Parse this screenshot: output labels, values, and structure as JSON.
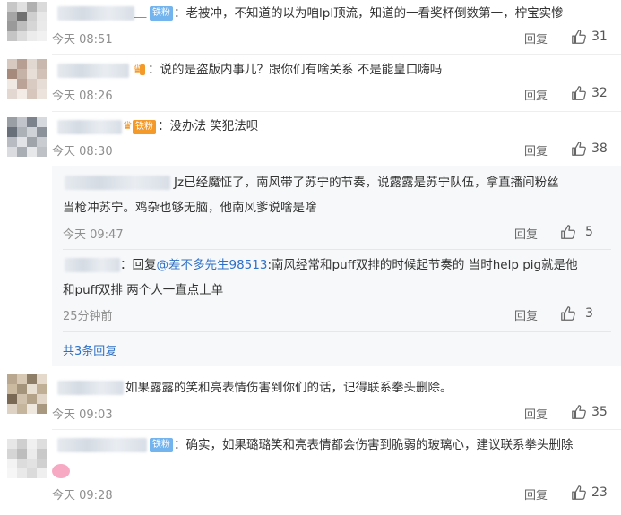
{
  "comments": [
    {
      "badge": "铁粉",
      "text": "：老被冲，不知道的以为咱lpl顶流，知道的一看奖杯倒数第一，柠宝实惨",
      "time": "今天 08:51",
      "reply_label": "回复",
      "likes": "31",
      "prefix": "＿",
      "avatar_colors": [
        "#c7c7c7",
        "#e0e0e0",
        "#b0b0b0",
        "#dadada",
        "#a5a5a5",
        "#707070",
        "#cfcfcf",
        "#e8e8e8",
        "#9a9a9a",
        "#bdbdbd",
        "#d6d6d6",
        "#eaeaea",
        "#c5c5c5",
        "#dcdcdc",
        "#ececec",
        "#f1f1f1"
      ]
    },
    {
      "badge": "",
      "text": "：说的是盗版内事儿？跟你们有啥关系 不是能皇口嗨吗",
      "time": "今天 08:26",
      "reply_label": "回复",
      "likes": "32",
      "avatar_colors": [
        "#d8c9c0",
        "#b89f94",
        "#e2d8d2",
        "#c9b8ad",
        "#a68a7c",
        "#c6b3a8",
        "#e8ded8",
        "#d2c1b7",
        "#f0e8e3",
        "#bba497",
        "#d9cbc2",
        "#e6ddd7",
        "#e3d8d1",
        "#f2ebe6",
        "#d7c6bc",
        "#ece3dd"
      ]
    },
    {
      "badge": "铁粉",
      "text": "：没办法  笑犯法呗",
      "time": "今天 08:30",
      "reply_label": "回复",
      "likes": "38",
      "avatar_colors": [
        "#9a9fa6",
        "#c1c5cb",
        "#7d838c",
        "#d6d9dd",
        "#686f78",
        "#acb1b8",
        "#cfd2d6",
        "#8c929a",
        "#b8bcc2",
        "#e1e3e6",
        "#9fa4ab",
        "#c9ccd0",
        "#dadcdf",
        "#a9aeb4",
        "#e6e8ea",
        "#bec2c7"
      ]
    },
    {
      "badge": "",
      "text": "如果露露的笑和亮表情伤害到你们的话，记得联系拳头删除。",
      "time": "今天 09:03",
      "reply_label": "回复",
      "likes": "35",
      "avatar_colors": [
        "#b9a88f",
        "#d7c8b4",
        "#8e7d67",
        "#e4d9ca",
        "#cbb9a0",
        "#a5947c",
        "#e9e0d4",
        "#c0ae95",
        "#7a6a55",
        "#d0c1ad",
        "#b3a188",
        "#e0d5c6",
        "#ddd2c3",
        "#c6b59d",
        "#efe8de",
        "#a99880"
      ]
    },
    {
      "badge": "铁粉",
      "text": "：确实，如果璐璐笑和亮表情都会伤害到脆弱的玻璃心，建议联系拳头删除",
      "time": "今天 09:28",
      "reply_label": "回复",
      "likes": "23",
      "avatar_colors": [
        "#e7e7e7",
        "#cfcfcf",
        "#f0f0f0",
        "#dedede",
        "#d5d5d5",
        "#bdbdbd",
        "#ebebeb",
        "#c9c9c9",
        "#f3f3f3",
        "#dcdcdc",
        "#e2e2e2",
        "#d0d0d0",
        "#f6f6f6",
        "#e9e9e9",
        "#dbdbdb",
        "#efefef"
      ]
    }
  ],
  "replies": [
    {
      "text_line1": "Jz已经魔怔了，南风带了苏宁的节奏，说露露是苏宁队伍，拿直播间粉丝",
      "text_line2": "当枪冲苏宁。鸡杂也够无脑，他南风爹说啥是啥",
      "time": "今天 09:47",
      "reply_label": "回复",
      "likes": "5"
    },
    {
      "prefix": "：回复",
      "mention": "@差不多先生98513",
      "text_line1": ":南风经常和puff双排的时候起节奏的 当时help pig就是他",
      "text_line2": "和puff双排 两个人一直点上单",
      "time": "25分钟前",
      "reply_label": "回复",
      "likes": "3"
    }
  ],
  "more_replies": "共3条回复",
  "colors": {
    "link": "#2e70c7",
    "badge_blue": "#73b3ee",
    "badge_gold": "#f39a2b",
    "time": "#8f8f8f"
  },
  "icons": {
    "like": "thumb-up-icon",
    "crown": "crown-icon",
    "sticker": "pink-bunny-sticker"
  }
}
